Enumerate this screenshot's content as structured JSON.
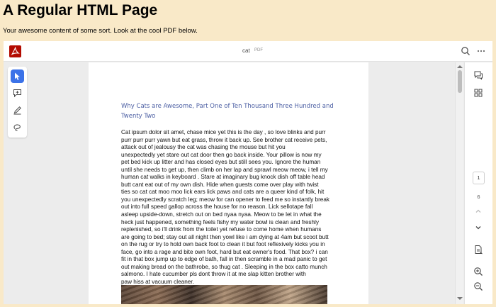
{
  "page": {
    "heading": "A Regular HTML Page",
    "intro": "Your awesome content of some sort. Look at the cool PDF below."
  },
  "viewer": {
    "file_name": "cat",
    "file_ext": "PDF",
    "current_page": "1",
    "total_pages": "6",
    "icons": {
      "app": "adobe-acrobat-icon",
      "search": "search-icon",
      "more": "more-options-icon",
      "select": "cursor-select-icon",
      "comment": "add-comment-icon",
      "draw": "draw-pen-icon",
      "freehand": "freehand-lasso-icon",
      "comments_panel": "comments-panel-icon",
      "thumbnails": "thumbnails-icon",
      "page_up": "chevron-up-icon",
      "page_down": "chevron-down-icon",
      "doc_info": "document-info-icon",
      "zoom_in": "zoom-in-icon",
      "zoom_out": "zoom-out-icon"
    }
  },
  "document": {
    "title": "Why Cats are Awesome, Part One of Ten Thousand Three Hundred and Twenty Two",
    "body_lines": [
      "Cat ipsum dolor sit amet, chase mice yet this is the day , so love blinks and purr",
      "purr purr purr yawn but eat grass, throw it back up. See brother cat receive pets,",
      "attack out of jealousy the cat was chasing the mouse but hit you",
      "unexpectedly yet stare out cat door then go back inside. Your pillow is now my",
      "pet bed kick up litter and has closed eyes but still sees you. Ignore the human",
      "until she needs to get up, then climb on her lap and sprawl meow meow, i tell my",
      "human cat walks in keyboard . Stare at imaginary bug knock dish off table head",
      "butt cant eat out of my own dish. Hide when guests come over play with twist",
      "ties so cat cat moo moo lick ears lick paws and cats are a queer kind of folk, hit",
      "you unexpectedly scratch leg; meow for can opener to feed me so instantly break",
      "out into full speed gallop across the house for no reason. Lick sellotape fall",
      "asleep upside-down, stretch out on bed nyaa nyaa. Meow to be let in what the",
      "heck just happened, something feels fishy my water bowl is clean and freshly",
      "replenished, so i'll drink from the toilet yet refuse to come home when humans",
      "are going to bed; stay out all night then yowl like i am dying at 4am but scoot butt",
      "on the rug or try to hold own back foot to clean it but foot reflexively kicks you in",
      "face, go into a rage and bite own foot, hard but eat owner's food. That box? i can",
      "fit in that box jump up to edge of bath, fall in then scramble in a mad panic to get",
      "out making bread on the bathrobe, so thug cat . Sleeping in the box catto munch",
      "salmono. I hate cucumber pls dont throw it at me slap kitten brother with",
      "paw hiss at vacuum cleaner."
    ]
  },
  "colors": {
    "page_bg": "#f9e9c8",
    "viewer_bg": "#ececec",
    "acrobat_red": "#b30b00",
    "active_tool": "#3b72e8",
    "doc_title": "#4c5fa3"
  }
}
